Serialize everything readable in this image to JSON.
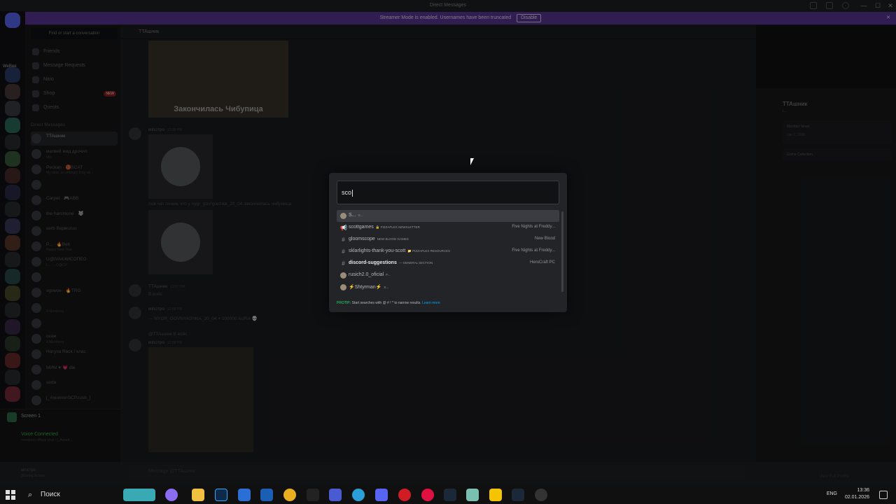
{
  "window": {
    "title": "Direct Messages"
  },
  "banner": {
    "text": "Streamer Mode is enabled. Usernames have been truncated",
    "button": "Disable"
  },
  "rail": {
    "label": "WeBee"
  },
  "sidebar": {
    "search_placeholder": "Find or start a conversation",
    "nav": [
      {
        "label": "Friends"
      },
      {
        "label": "Message Requests"
      },
      {
        "label": "Nitro"
      },
      {
        "label": "Shop",
        "badge": "NEW"
      },
      {
        "label": "Quests"
      }
    ],
    "dm_header": "Direct Messages",
    "dms": [
      {
        "name": "TTAшник",
        "sub": ""
      },
      {
        "name": "матвей жид дрочил",
        "sub": "Idle"
      },
      {
        "name": "Peckan · 🏀SCAT",
        "sub": "My dear, so ordinary forty so..."
      },
      {
        "name": "",
        "sub": ""
      },
      {
        "name": "Carpet · 🎮ABB",
        "sub": ""
      },
      {
        "name": "the harshtone · 🐺",
        "sub": ""
      },
      {
        "name": "serb Варвоzuo",
        "sub": ""
      },
      {
        "name": "P... · 🔥Belt",
        "sub": "Happy New Year"
      },
      {
        "name": "U@IVAK4ИСОПЕО",
        "sub": "I... · ...O@ОУ"
      },
      {
        "name": "",
        "sub": ""
      },
      {
        "name": "vgswoe · 🔥TRG",
        "sub": ""
      },
      {
        "name": "",
        "sub": "3 Members"
      },
      {
        "name": "",
        "sub": ""
      },
      {
        "name": "скаж",
        "sub": "4 Members"
      },
      {
        "name": "Натуха Rack / клас",
        "sub": ""
      },
      {
        "name": "МИМ ♥ 💗 die",
        "sub": ""
      },
      {
        "name": "seda",
        "sub": ""
      },
      {
        "name": "[_AxiomonSCP.rush_]",
        "sub": ""
      }
    ],
    "voice": {
      "screen_label": "Screen 1",
      "status": "Voice Connected",
      "channel": "members official chat / [_Axiom..."
    },
    "user": {
      "name": "міпстро",
      "status": "Sharing Screen"
    }
  },
  "chat": {
    "channel_name": "TTAшник",
    "image_caption": "Закончилась Чибупица",
    "messages": [
      {
        "author": "міпстро",
        "time": "12:39 PM",
        "text": ""
      },
      {
        "text": "лов чат пониж что у nygr_govnyashka_20_04 закончилась чибуница"
      },
      {
        "author": "TTAшник",
        "time": "12:57 PM",
        "text": "В войс"
      },
      {
        "author": "міпстро",
        "time": "12:58 PM",
        "text": "→ NYGR_GOVNYASHKA_20_04 + 100000 AURA 💀"
      },
      {
        "reply": "@TTAшник В войс",
        "author": "міпстро",
        "time": "12:58 PM",
        "text": ""
      }
    ],
    "input_placeholder": "Message @TTAшник"
  },
  "profile": {
    "name": "TTAшник",
    "sub": "t...",
    "member_since_label": "Member Since",
    "member_since_value": "Jan 1, 2026",
    "game_collection": "Game Collection",
    "footer": "View Full Profile"
  },
  "switcher": {
    "query": "sco",
    "results": [
      {
        "icon": "avatar",
        "name": "S...",
        "category": "s...",
        "server": "",
        "selected": true
      },
      {
        "icon": "announce",
        "name": "scottgames",
        "category": "🔒 PIZZAPLEX NEWSLETTER",
        "server": "Five Nights at Freddy...",
        "selected": false
      },
      {
        "icon": "hash",
        "name": "gloomscope",
        "category": "NEW BLOOD GAMES",
        "server": "New Blood",
        "selected": false
      },
      {
        "icon": "hash",
        "name": "sklarlights-thank-you-scott",
        "category": "📁 PIZZAPLEX RESOURCES",
        "server": "Five Nights at Freddy...",
        "selected": false
      },
      {
        "icon": "hash",
        "name": "discord-suggestions",
        "category": "— GENERAL SECTION",
        "server": "HeroCraft PC",
        "selected": false,
        "bold": true
      },
      {
        "icon": "avatar",
        "name": "rusich2.0_oficial",
        "category": "p...",
        "server": "",
        "selected": false
      },
      {
        "icon": "avatar",
        "name": "⚡Shtyrman⚡",
        "category": "s...",
        "server": "",
        "selected": false
      }
    ],
    "tip": {
      "prefix": "PROTIP:",
      "text": "Start searches with @ # ! * to narrow results.",
      "link": "Learn more"
    }
  },
  "taskbar": {
    "search": "Поиск",
    "lang": "ENG",
    "time": "13:36",
    "date": "02.01.2026"
  }
}
